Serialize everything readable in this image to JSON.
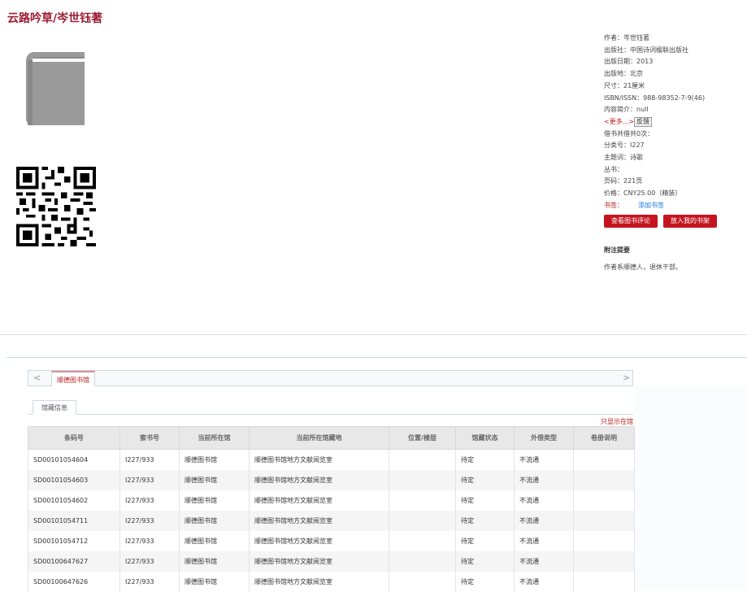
{
  "title": "云路吟草/岑世钰著",
  "meta": {
    "author": "作者：岑世钰著",
    "publisher": "出版社：中国诗词楹联出版社",
    "pub_date": "出版日期：2013",
    "pub_place": "出版地：北京",
    "size": "尺寸：21厘米",
    "isbn": "ISBN/ISSN：988-98352-7-9(46)",
    "summary": "内容简介：null",
    "more": "<更多...>",
    "feedback": "反馈",
    "borrow_count": "借书共借共0次：",
    "class_no": "分类号：I227",
    "subject": "主题词：诗歌",
    "series": "丛书：",
    "pages": "页码：221页",
    "price": "价格：CNY25.00（精装）",
    "shelf_label": "书签：",
    "shelf_link": "添加书签"
  },
  "buttons": {
    "view_reviews": "查看图书评论",
    "add_shelf": "放入我的书架"
  },
  "note": {
    "title": "附注提要",
    "text": "作者系顺德人，退休干部。"
  },
  "tabs": {
    "prev": "<",
    "next": ">",
    "active": "顺德图书馆"
  },
  "subtab": "馆藏信息",
  "dist_link": "只显示在馆",
  "table": {
    "headers": [
      "条码号",
      "索书号",
      "当前所在馆",
      "当前所在馆藏地",
      "位置/楼层",
      "馆藏状态",
      "外借类型",
      "卷册说明"
    ],
    "rows": [
      [
        "SD00101054604",
        "I227/933",
        "顺德图书馆",
        "顺德图书馆地方文献阅览室",
        "",
        "待定",
        "不流通",
        ""
      ],
      [
        "SD00101054603",
        "I227/933",
        "顺德图书馆",
        "顺德图书馆地方文献阅览室",
        "",
        "待定",
        "不流通",
        ""
      ],
      [
        "SD00101054602",
        "I227/933",
        "顺德图书馆",
        "顺德图书馆地方文献阅览室",
        "",
        "待定",
        "不流通",
        ""
      ],
      [
        "SD00101054711",
        "I227/933",
        "顺德图书馆",
        "顺德图书馆地方文献阅览室",
        "",
        "待定",
        "不流通",
        ""
      ],
      [
        "SD00101054712",
        "I227/933",
        "顺德图书馆",
        "顺德图书馆地方文献阅览室",
        "",
        "待定",
        "不流通",
        ""
      ],
      [
        "SD00100647627",
        "I227/933",
        "顺德图书馆",
        "顺德图书馆地方文献阅览室",
        "",
        "待定",
        "不流通",
        ""
      ],
      [
        "SD00100647626",
        "I227/933",
        "顺德图书馆",
        "顺德图书馆地方文献阅览室",
        "",
        "待定",
        "不流通",
        ""
      ]
    ]
  },
  "colors": {
    "title": "#9b1c31",
    "button": "#c4141f",
    "link": "#1a73e8"
  }
}
